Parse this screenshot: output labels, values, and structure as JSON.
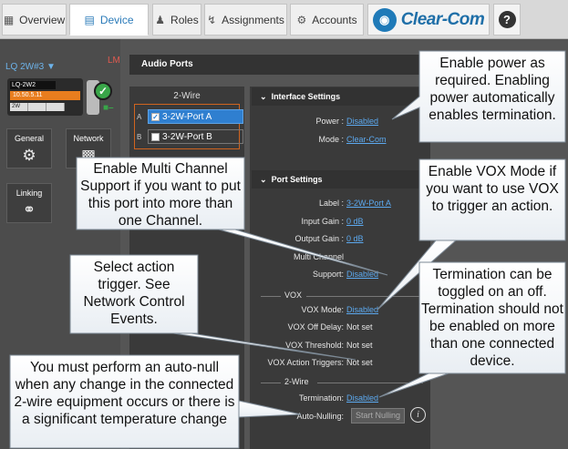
{
  "nav": {
    "tabs": [
      {
        "label": "Overview",
        "icon": "grid-icon"
      },
      {
        "label": "Device",
        "icon": "device-icon"
      },
      {
        "label": "Roles",
        "icon": "roles-icon"
      },
      {
        "label": "Assignments",
        "icon": "assignments-icon"
      },
      {
        "label": "Accounts",
        "icon": "accounts-icon"
      }
    ],
    "active_tab": "Device",
    "brand": "Clear-Com",
    "help_icon": "?"
  },
  "sidebar": {
    "device_selector": "LQ 2W#3",
    "lm_badge": "LM",
    "device_card": {
      "name": "LQ-2W2",
      "ip": "10.50.5.11",
      "slot": "2W"
    },
    "buttons": [
      {
        "label": "General",
        "icon": "gear-icon"
      },
      {
        "label": "Network",
        "icon": "network-icon"
      },
      {
        "label": "Linking",
        "icon": "link-icon"
      }
    ]
  },
  "main": {
    "header": "Audio Ports",
    "port_group_label": "2-Wire",
    "ports": [
      {
        "letter": "A",
        "label": "3-2W-Port A",
        "checked": true
      },
      {
        "letter": "B",
        "label": "3-2W-Port B",
        "checked": false
      }
    ],
    "interface_settings": {
      "title": "Interface Settings",
      "power_label": "Power :",
      "power_value": "Disabled",
      "mode_label": "Mode :",
      "mode_value": "Clear-Com"
    },
    "port_settings": {
      "title": "Port Settings",
      "label_label": "Label :",
      "label_value": "3-2W-Port A",
      "input_gain_label": "Input Gain :",
      "input_gain_value": "0 dB",
      "output_gain_label": "Output Gain :",
      "output_gain_value": "0 dB",
      "multi_channel_label": "Multi Channel",
      "support_label": "Support:",
      "support_value": "Disabled"
    },
    "vox": {
      "title": "VOX",
      "mode_label": "VOX Mode:",
      "mode_value": "Disabled",
      "off_delay_label": "VOX Off Delay:",
      "off_delay_value": "Not set",
      "threshold_label": "VOX Threshold:",
      "threshold_value": "Not set",
      "action_triggers_label": "VOX Action Triggers:",
      "action_triggers_value": "Not set"
    },
    "two_wire": {
      "title": "2-Wire",
      "termination_label": "Termination:",
      "termination_value": "Disabled",
      "auto_nulling_label": "Auto-Nulling:",
      "start_nulling_button": "Start Nulling",
      "info_icon": "i"
    }
  },
  "callouts": [
    {
      "id": "power",
      "text": "Enable power as required. Enabling power automatically enables termination."
    },
    {
      "id": "multichannel",
      "text": "Enable Multi Channel Support if you want to put this port into more than one Channel."
    },
    {
      "id": "vox",
      "text": "Enable VOX Mode if you want to use VOX to trigger an action."
    },
    {
      "id": "action",
      "text": "Select action trigger. See Network Control Events."
    },
    {
      "id": "termination",
      "text": "Termination can be toggled on an off. Termination should not be enabled on more than one connected device."
    },
    {
      "id": "autonull",
      "text": "You must perform an auto-null when any change in the connected 2-wire equipment occurs or there is a significant temperature change"
    }
  ]
}
